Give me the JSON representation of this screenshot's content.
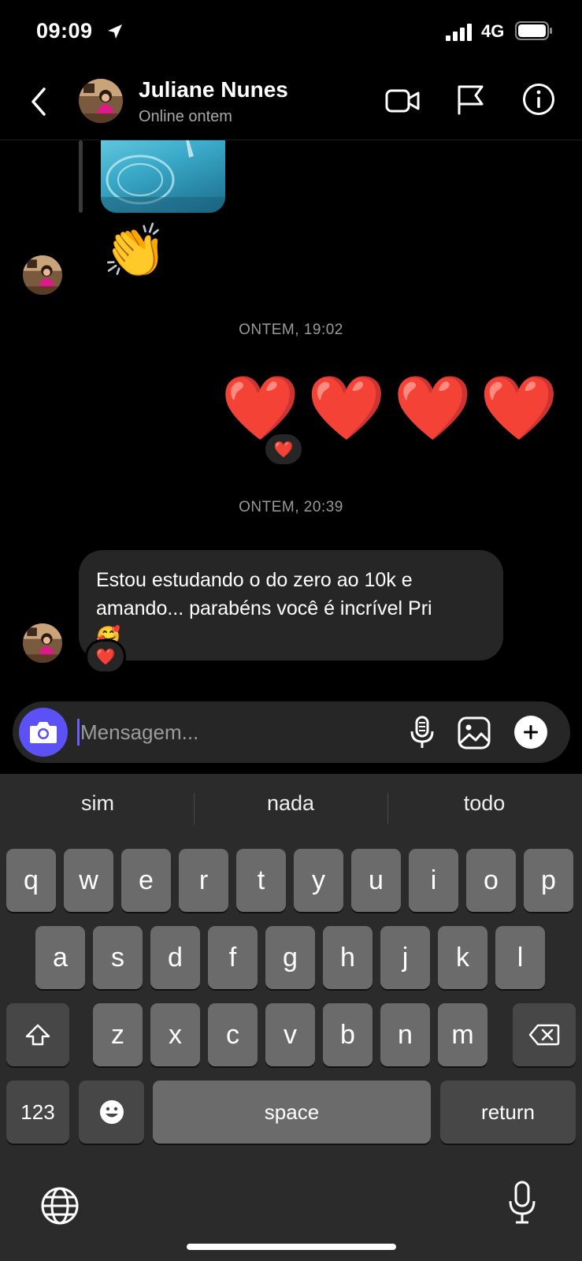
{
  "status_bar": {
    "time": "09:09",
    "network": "4G"
  },
  "header": {
    "contact_name": "Juliane Nunes",
    "contact_status": "Online ontem"
  },
  "thread": {
    "clap_emoji": "👏",
    "timestamp_1": "ONTEM, 19:02",
    "hearts": "❤️❤️❤️❤️",
    "hearts_reaction": "❤️",
    "timestamp_2": "ONTEM, 20:39",
    "incoming_message": "Estou estudando o do zero ao 10k e\namando... parabéns você é incrível Pri\n🥰",
    "incoming_reaction": "❤️"
  },
  "composer": {
    "placeholder": "Mensagem..."
  },
  "keyboard": {
    "suggestions": [
      "sim",
      "nada",
      "todo"
    ],
    "row1": [
      "q",
      "w",
      "e",
      "r",
      "t",
      "y",
      "u",
      "i",
      "o",
      "p"
    ],
    "row2": [
      "a",
      "s",
      "d",
      "f",
      "g",
      "h",
      "j",
      "k",
      "l"
    ],
    "row3": [
      "z",
      "x",
      "c",
      "v",
      "b",
      "n",
      "m"
    ],
    "numbers_key": "123",
    "space_key": "space",
    "return_key": "return"
  },
  "colors": {
    "accent": "#5b51f5",
    "bubble": "#262626",
    "heart": "#ff1d3a"
  }
}
